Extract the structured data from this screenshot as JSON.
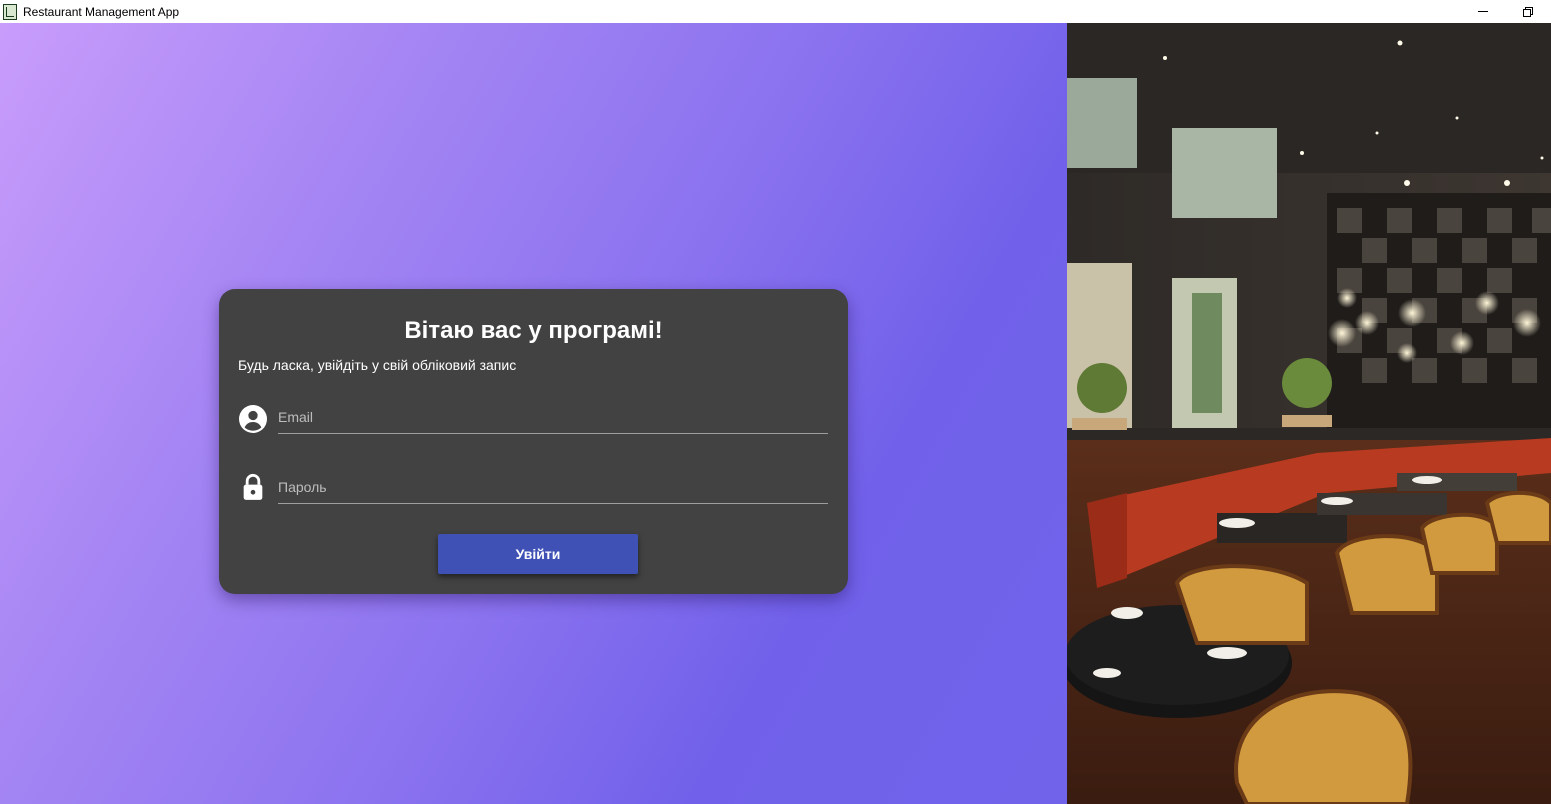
{
  "window": {
    "title": "Restaurant Management App"
  },
  "login": {
    "title": "Вітаю вас у програмі!",
    "subtitle": "Будь ласка, увійдіть у свій обліковий запис",
    "email_placeholder": "Email",
    "email_value": "",
    "password_placeholder": "Пароль",
    "password_value": "",
    "submit_label": "Увійти"
  },
  "icons": {
    "email": "account-circle-icon",
    "password": "lock-icon"
  },
  "colors": {
    "gradient_start": "#c89cfb",
    "gradient_end": "#7164eb",
    "card_background": "#424242",
    "button_primary": "#3f51b5"
  }
}
